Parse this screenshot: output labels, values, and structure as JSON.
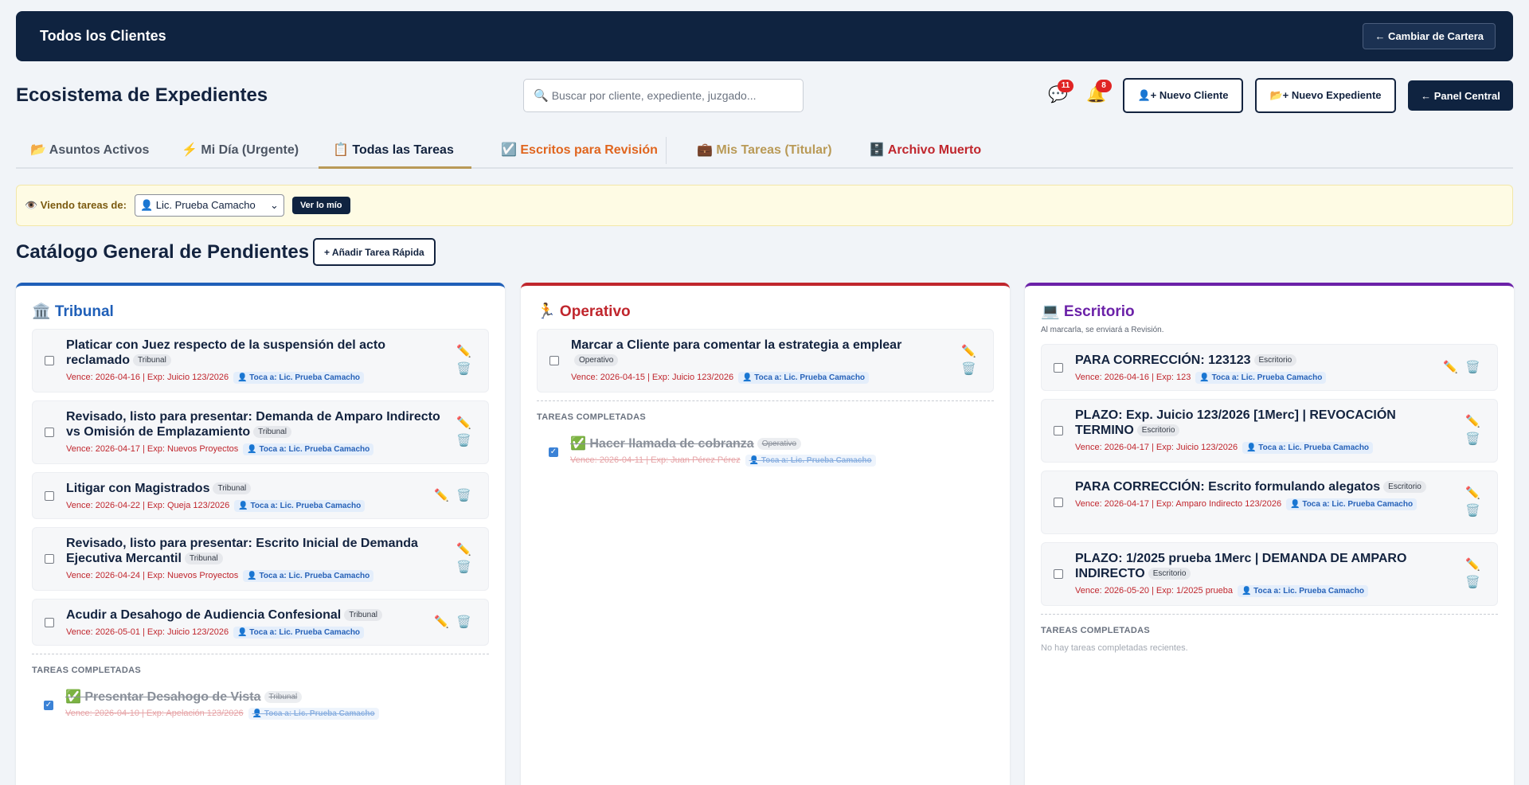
{
  "topbar": {
    "title": "Todos los Clientes",
    "change_label": "← Cambiar de Cartera"
  },
  "header": {
    "title": "Ecosistema de Expedientes",
    "search_placeholder": "Buscar por cliente, expediente, juzgado...",
    "messages_count": "11",
    "notifications_count": "8",
    "new_client_label": "👤+ Nuevo Cliente",
    "new_file_label": "📂+ Nuevo Expediente",
    "panel_label": "← Panel Central"
  },
  "tabs": [
    {
      "label": "📂 Asuntos Activos",
      "color": "#4c5563"
    },
    {
      "label": "⚡ Mi Día (Urgente)",
      "color": "#4c5563"
    },
    {
      "label": "📋 Todas las Tareas",
      "color": "#13233f"
    },
    {
      "label": "☑️ Escritos para Revisión",
      "color": "#e0651e"
    },
    {
      "label": "💼 Mis Tareas (Titular)",
      "color": "#b99a57"
    },
    {
      "label": "🗄️ Archivo Muerto",
      "color": "#c0262d"
    }
  ],
  "filter": {
    "label": "👁️ Viendo tareas de:",
    "selected": "👤 Lic. Prueba Camacho",
    "mine_label": "Ver lo mío"
  },
  "section": {
    "title": "Catálogo General de Pendientes",
    "quick_add_label": "+ Añadir Tarea Rápida"
  },
  "columns": {
    "tribunal": {
      "title": "🏛️ Tribunal",
      "color": "#1f5fb8",
      "cards": [
        {
          "title": "Platicar con Juez respecto de la suspensión del acto reclamado",
          "tag": "Tribunal",
          "meta": "Vence: 2026-04-16 | Exp: Juicio 123/2026",
          "assignee": "👤 Toca a: Lic. Prueba Camacho"
        },
        {
          "title": "Revisado, listo para presentar: Demanda de Amparo Indirecto vs Omisión de Emplazamiento",
          "tag": "Tribunal",
          "meta": "Vence: 2026-04-17 | Exp: Nuevos Proyectos",
          "assignee": "👤 Toca a: Lic. Prueba Camacho"
        },
        {
          "title": "Litigar con Magistrados",
          "tag": "Tribunal",
          "meta": "Vence: 2026-04-22 | Exp: Queja 123/2026",
          "assignee": "👤 Toca a: Lic. Prueba Camacho"
        },
        {
          "title": "Revisado, listo para presentar: Escrito Inicial de Demanda Ejecutiva Mercantil",
          "tag": "Tribunal",
          "meta": "Vence: 2026-04-24 | Exp: Nuevos Proyectos",
          "assignee": "👤 Toca a: Lic. Prueba Camacho"
        },
        {
          "title": "Acudir a Desahogo de Audiencia Confesional",
          "tag": "Tribunal",
          "meta": "Vence: 2026-05-01 | Exp: Juicio 123/2026",
          "assignee": "👤 Toca a: Lic. Prueba Camacho"
        }
      ],
      "done_header": "TAREAS COMPLETADAS",
      "done": [
        {
          "title": "✅ Presentar Desahogo de Vista",
          "tag": "Tribunal",
          "meta": "Vence: 2026-04-10 | Exp: Apelación 123/2026",
          "assignee": "👤 Toca a: Lic. Prueba Camacho"
        }
      ]
    },
    "operativo": {
      "title": "🏃 Operativo",
      "color": "#c0262d",
      "cards": [
        {
          "title": "Marcar a Cliente para comentar la estrategia a emplear",
          "tag": "Operativo",
          "meta": "Vence: 2026-04-15 | Exp: Juicio 123/2026",
          "assignee": "👤 Toca a: Lic. Prueba Camacho"
        }
      ],
      "done_header": "TAREAS COMPLETADAS",
      "done": [
        {
          "title": "✅ Hacer llamada de cobranza",
          "tag": "Operativo",
          "meta": "Vence: 2026-04-11 | Exp: Juan Pérez Pérez",
          "assignee": "👤 Toca a: Lic. Prueba Camacho"
        }
      ]
    },
    "escritorio": {
      "title": "💻 Escritorio",
      "color": "#6b21a8",
      "note": "Al marcarla, se enviará a Revisión.",
      "cards": [
        {
          "title": "PARA CORRECCIÓN: 123123",
          "tag": "Escritorio",
          "meta": "Vence: 2026-04-16 | Exp: 123",
          "assignee": "👤 Toca a: Lic. Prueba Camacho"
        },
        {
          "title": "PLAZO: Exp. Juicio 123/2026 [1Merc] | REVOCACIÓN TERMINO",
          "tag": "Escritorio",
          "meta": "Vence: 2026-04-17 | Exp: Juicio 123/2026",
          "assignee": "👤 Toca a: Lic. Prueba Camacho"
        },
        {
          "title": "PARA CORRECCIÓN: Escrito formulando alegatos",
          "tag": "Escritorio",
          "meta": "Vence: 2026-04-17 | Exp: Amparo Indirecto 123/2026",
          "assignee": "👤 Toca a: Lic. Prueba Camacho"
        },
        {
          "title": "PLAZO: 1/2025 prueba 1Merc | DEMANDA DE AMPARO INDIRECTO",
          "tag": "Escritorio",
          "meta": "Vence: 2026-05-20 | Exp: 1/2025 prueba",
          "assignee": "👤 Toca a: Lic. Prueba Camacho"
        }
      ],
      "done_header": "TAREAS COMPLETADAS",
      "empty_done": "No hay tareas completadas recientes."
    }
  },
  "icons": {
    "search": "🔍",
    "messages": "💬",
    "bell": "🔔",
    "edit": "✏️",
    "delete": "🗑️",
    "select_arrow": "⌄"
  }
}
